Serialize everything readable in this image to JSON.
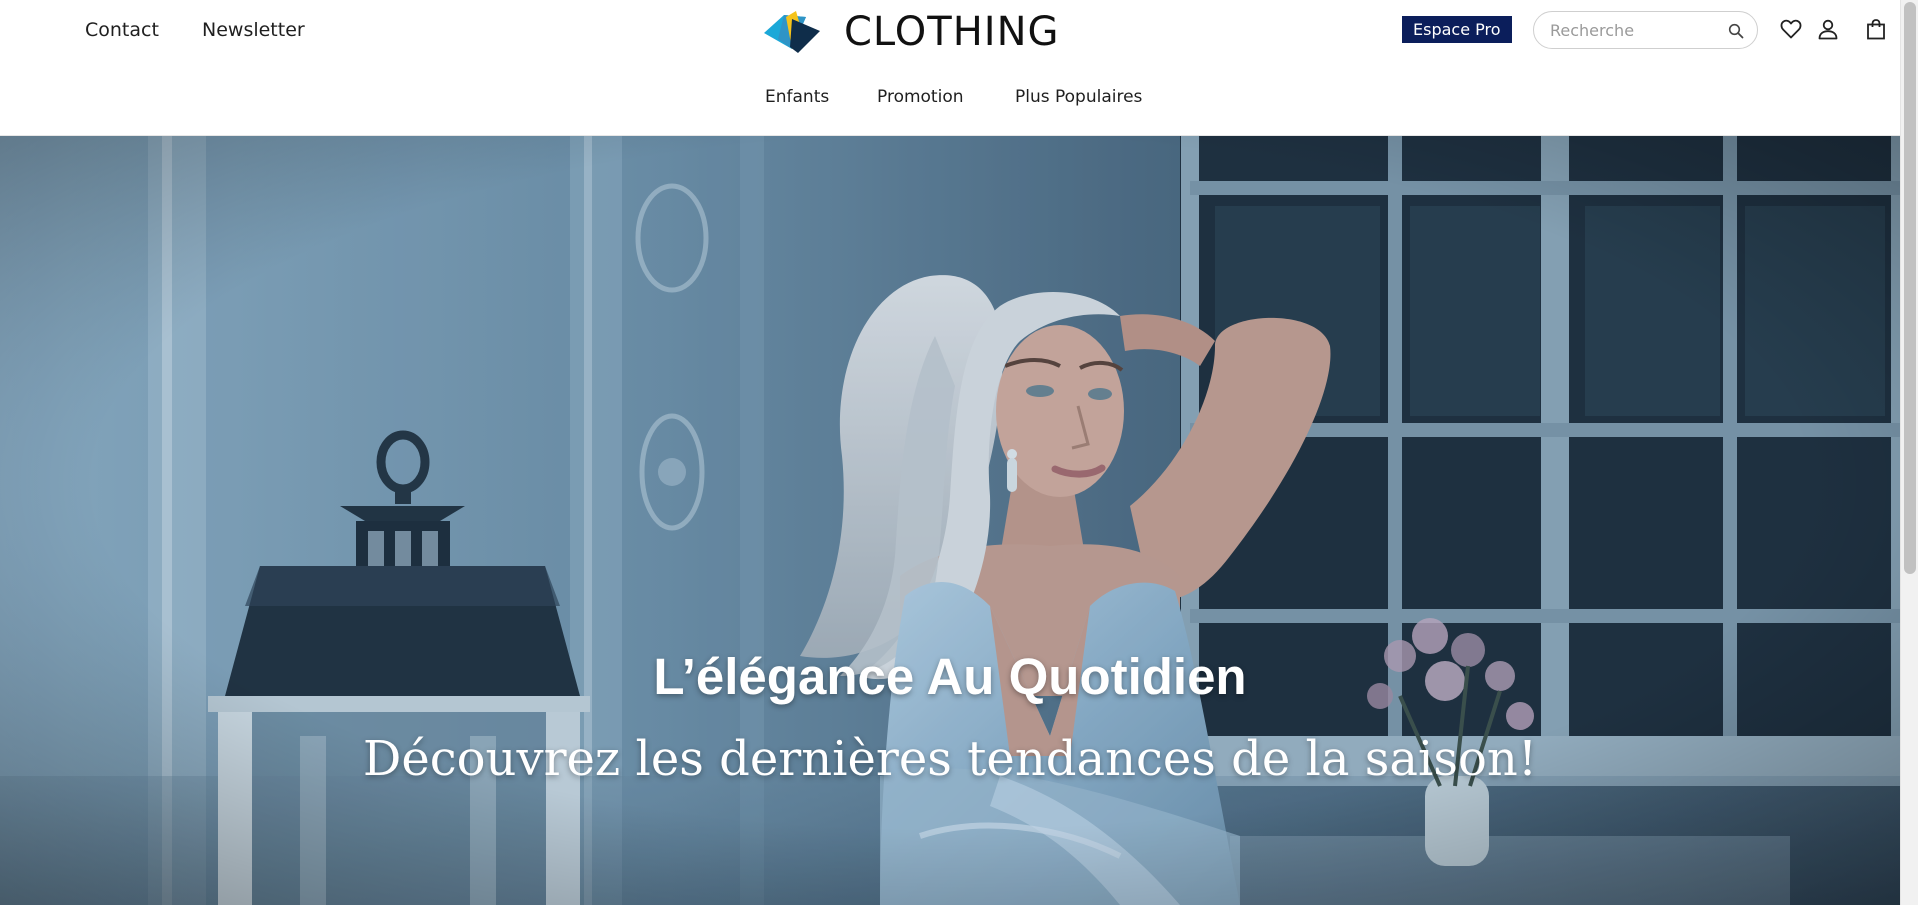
{
  "header": {
    "top_links": {
      "contact": "Contact",
      "newsletter": "Newsletter"
    },
    "logo": {
      "text": "CLOTHING",
      "colors": {
        "cyan": "#1ba8d8",
        "navy": "#0f2d4a",
        "yellow": "#f5c31b"
      }
    },
    "espace_pro": {
      "label": "Espace Pro",
      "background": "#0b1e5b"
    },
    "search": {
      "placeholder": "Recherche",
      "value": "",
      "icon": "search-icon"
    },
    "icons": [
      "heart-icon",
      "user-icon",
      "bag-icon"
    ],
    "nav": {
      "enfants": "Enfants",
      "promotion": "Promotion",
      "populaires": "Plus Populaires"
    }
  },
  "hero": {
    "title": "L’élégance Au Quotidien",
    "subtitle": "Découvrez les dernières tendances de la saison!"
  }
}
